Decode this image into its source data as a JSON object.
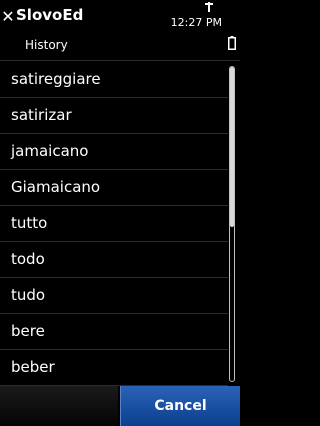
{
  "header": {
    "title": "SlovoEd",
    "subtitle": "History",
    "time": "12:27 PM",
    "close_icon": "close-icon",
    "signal_icon": "signal-icon",
    "battery_icon": "battery-icon"
  },
  "history": {
    "items": [
      "satireggiare",
      "satirizar",
      "jamaicano",
      "Giamaicano",
      "tutto",
      "todo",
      "tudo",
      "bere",
      "beber"
    ],
    "scroll_position": 0.0
  },
  "toolbar": {
    "cancel_label": "Cancel"
  },
  "colors": {
    "background": "#000000",
    "text": "#ffffff",
    "separator": "#2c2c2c",
    "accent": "#1f55a8"
  }
}
